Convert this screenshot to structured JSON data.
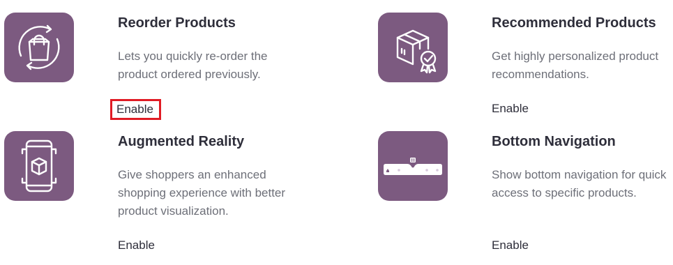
{
  "features": [
    {
      "title": "Reorder Products",
      "description": "Lets you quickly re-order the product ordered previously.",
      "action_label": "Enable",
      "icon": "reorder-bag-icon",
      "highlighted": true
    },
    {
      "title": "Recommended Products",
      "description": "Get highly personalized product recommendations.",
      "action_label": "Enable",
      "icon": "box-badge-icon",
      "highlighted": false
    },
    {
      "title": "Augmented Reality",
      "description": "Give shoppers an enhanced shopping experience with better product visualization.",
      "action_label": "Enable",
      "icon": "ar-cube-icon",
      "highlighted": false
    },
    {
      "title": "Bottom Navigation",
      "description": "Show bottom navigation for quick access to specific products.",
      "action_label": "Enable",
      "icon": "bottom-nav-bar-icon",
      "highlighted": false
    }
  ],
  "colors": {
    "tile_background": "#7c5a80",
    "highlight_outline": "#e01b24",
    "title_text": "#2e2e3a",
    "description_text": "#6d6f78"
  }
}
